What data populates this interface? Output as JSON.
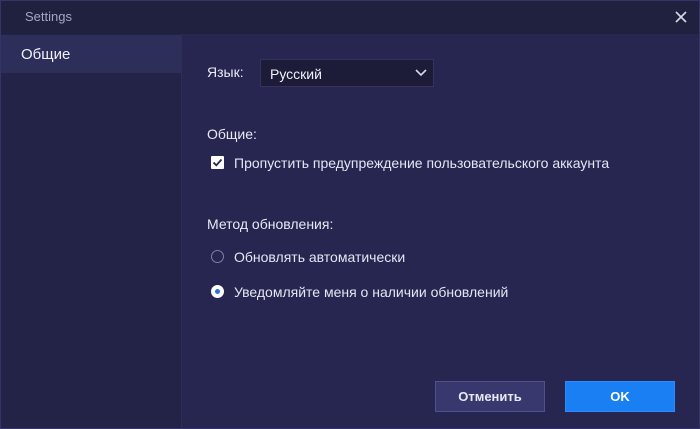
{
  "window": {
    "title": "Settings"
  },
  "sidebar": {
    "items": [
      {
        "label": "Общие",
        "selected": true
      }
    ]
  },
  "main": {
    "language": {
      "label": "Язык:",
      "selected": "Русский"
    },
    "general": {
      "title": "Общие:",
      "checkbox": {
        "label": "Пропустить предупреждение пользовательского аккаунта",
        "checked": true
      }
    },
    "update": {
      "title": "Метод обновления:",
      "options": [
        {
          "label": "Обновлять автоматически",
          "checked": false
        },
        {
          "label": "Уведомляйте меня о наличии обновлений",
          "checked": true
        }
      ]
    }
  },
  "footer": {
    "cancel_label": "Отменить",
    "ok_label": "OK"
  },
  "colors": {
    "background": "#262650",
    "sidebar": "#232347",
    "accent": "#1a7ff2"
  },
  "icons": {
    "close": "close-icon",
    "dropdown": "chevron-down-icon",
    "check": "checkmark-icon"
  }
}
